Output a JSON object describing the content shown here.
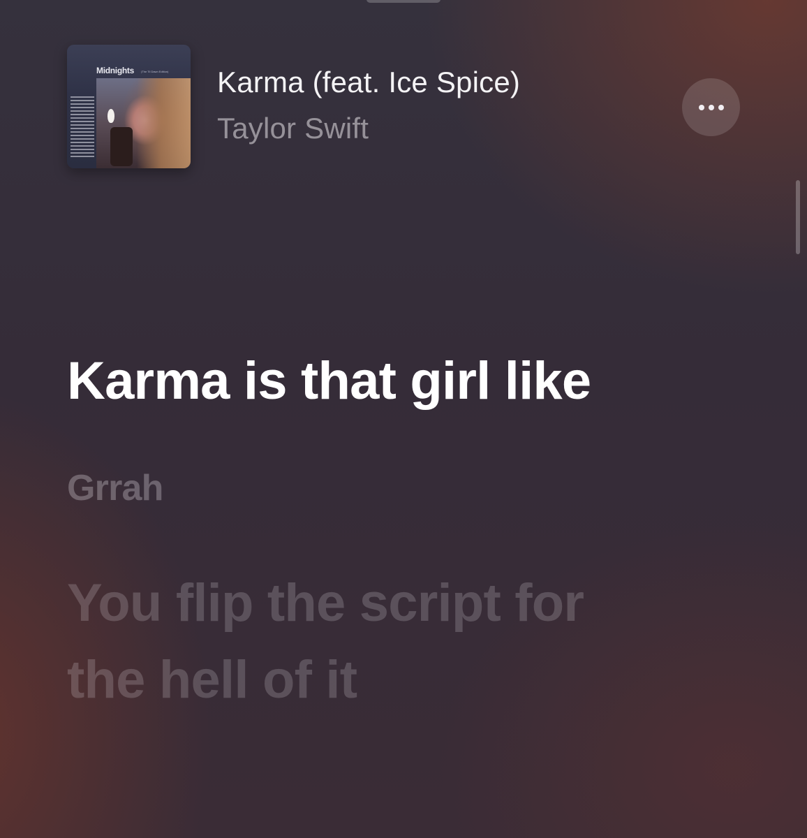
{
  "now_playing": {
    "artwork": {
      "album_name": "Midnights",
      "edition": "(The Til Dawn Edition)"
    },
    "title": "Karma (feat. Ice Spice)",
    "artist": "Taylor Swift",
    "more_icon": "ellipsis-icon"
  },
  "lyrics": [
    "Karma is that girl like",
    "Grrah",
    "You flip the script for the hell of it"
  ],
  "colors": {
    "background_top": "#35313d",
    "background_accent": "#6e3a30",
    "lyric_active": "#ffffff",
    "lyric_dimmed": "rgba(235,228,235,0.30)"
  }
}
